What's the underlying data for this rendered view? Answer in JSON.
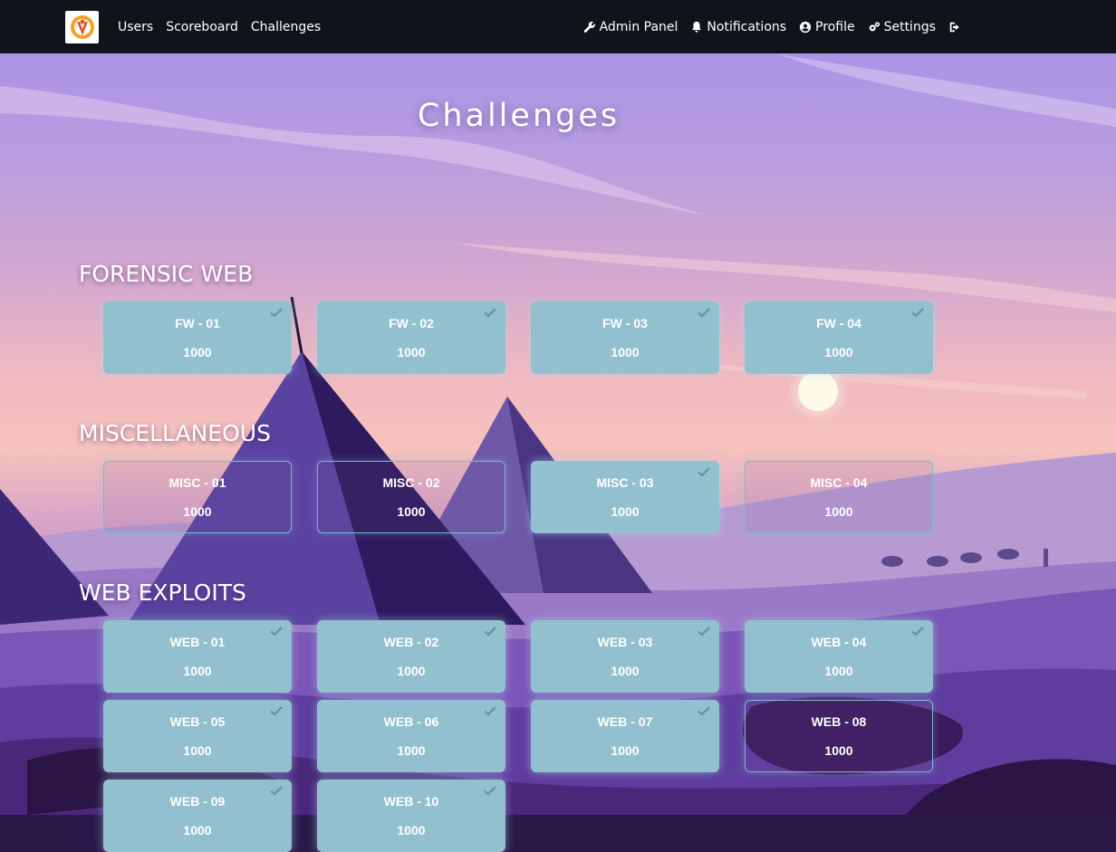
{
  "nav": {
    "left": [
      {
        "label": "Users"
      },
      {
        "label": "Scoreboard"
      },
      {
        "label": "Challenges"
      }
    ],
    "right": [
      {
        "label": "Admin Panel",
        "icon": "wrench-icon"
      },
      {
        "label": "Notifications",
        "icon": "bell-icon"
      },
      {
        "label": "Profile",
        "icon": "user-circle-icon"
      },
      {
        "label": "Settings",
        "icon": "cogs-icon"
      },
      {
        "label": "",
        "icon": "sign-out-icon"
      }
    ]
  },
  "page": {
    "title": "Challenges"
  },
  "colors": {
    "solved_card": "#93c0cf",
    "unsolved_border": "#7fb7c6",
    "navbar": "#10131a"
  },
  "categories": [
    {
      "name": "FORENSIC WEB",
      "challenges": [
        {
          "name": "FW - 01",
          "value": "1000",
          "solved": true
        },
        {
          "name": "FW - 02",
          "value": "1000",
          "solved": true
        },
        {
          "name": "FW - 03",
          "value": "1000",
          "solved": true
        },
        {
          "name": "FW - 04",
          "value": "1000",
          "solved": true
        }
      ]
    },
    {
      "name": "MISCELLANEOUS",
      "challenges": [
        {
          "name": "MISC - 01",
          "value": "1000",
          "solved": false
        },
        {
          "name": "MISC - 02",
          "value": "1000",
          "solved": false
        },
        {
          "name": "MISC - 03",
          "value": "1000",
          "solved": true
        },
        {
          "name": "MISC - 04",
          "value": "1000",
          "solved": false
        }
      ]
    },
    {
      "name": "WEB EXPLOITS",
      "challenges": [
        {
          "name": "WEB - 01",
          "value": "1000",
          "solved": true
        },
        {
          "name": "WEB - 02",
          "value": "1000",
          "solved": true
        },
        {
          "name": "WEB - 03",
          "value": "1000",
          "solved": true
        },
        {
          "name": "WEB - 04",
          "value": "1000",
          "solved": true
        },
        {
          "name": "WEB - 05",
          "value": "1000",
          "solved": true
        },
        {
          "name": "WEB - 06",
          "value": "1000",
          "solved": true
        },
        {
          "name": "WEB - 07",
          "value": "1000",
          "solved": true
        },
        {
          "name": "WEB - 08",
          "value": "1000",
          "solved": false
        },
        {
          "name": "WEB - 09",
          "value": "1000",
          "solved": true
        },
        {
          "name": "WEB - 10",
          "value": "1000",
          "solved": true
        }
      ]
    }
  ]
}
